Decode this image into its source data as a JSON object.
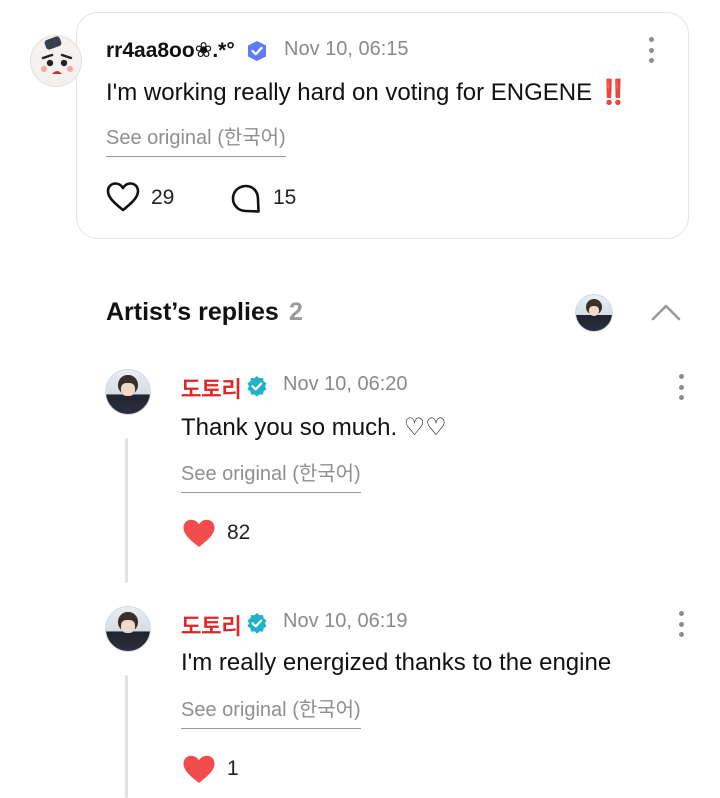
{
  "post": {
    "author": "rr4aa8oo❀.*°",
    "timestamp": "Nov 10, 06:15",
    "text": "I'm working really hard on voting for ENGENE ‼️",
    "see_original": "See original",
    "original_language": "(한국어)",
    "like_count": "29",
    "comment_count": "15"
  },
  "artist_replies": {
    "title": "Artist’s replies",
    "count": "2",
    "replies": [
      {
        "author": "도토리",
        "timestamp": "Nov 10, 06:20",
        "text": "Thank you so much. ♡♡",
        "see_original": "See original",
        "original_language": "(한국어)",
        "like_count": "82"
      },
      {
        "author": "도토리",
        "timestamp": "Nov 10, 06:19",
        "text": "I'm really energized thanks to the engine",
        "see_original": "See original",
        "original_language": "(한국어)",
        "like_count": "1"
      }
    ]
  },
  "colors": {
    "artist_name": "#e02525",
    "heart_filled": "#f24b4b",
    "verified_artist": "#1fb2c9",
    "verified_user": "#5b7cf6",
    "muted_text": "#8a8a8a"
  },
  "icons": {
    "like": "heart-outline-icon",
    "comment": "speech-bubble-icon",
    "liked": "heart-filled-icon",
    "more": "kebab-menu-icon",
    "collapse": "chevron-up-icon",
    "verified": "verified-badge-icon"
  }
}
